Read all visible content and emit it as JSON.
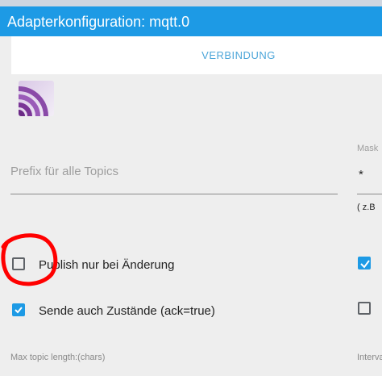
{
  "window": {
    "title": "Adapterkonfiguration: mqtt.0"
  },
  "tabs": [
    {
      "label": "VERBINDUNG"
    }
  ],
  "fields": {
    "prefix": {
      "placeholder": "Prefix für alle Topics",
      "value": ""
    },
    "mask": {
      "label": "Mask",
      "value": "*",
      "hint": "( z.B"
    }
  },
  "checkboxes": [
    {
      "label": "Publish nur bei Änderung",
      "checked": false
    },
    {
      "label": "Sende auch Zustände (ack=true)",
      "checked": true
    }
  ],
  "right_column": {
    "checkbox_1_checked": true,
    "checkbox_2_checked": false,
    "interval_label": "Interva"
  },
  "bottom": {
    "max_topic_label": "Max topic length:(chars)"
  },
  "colors": {
    "accent": "#1d9ae5",
    "annotation": "#ff0000"
  }
}
